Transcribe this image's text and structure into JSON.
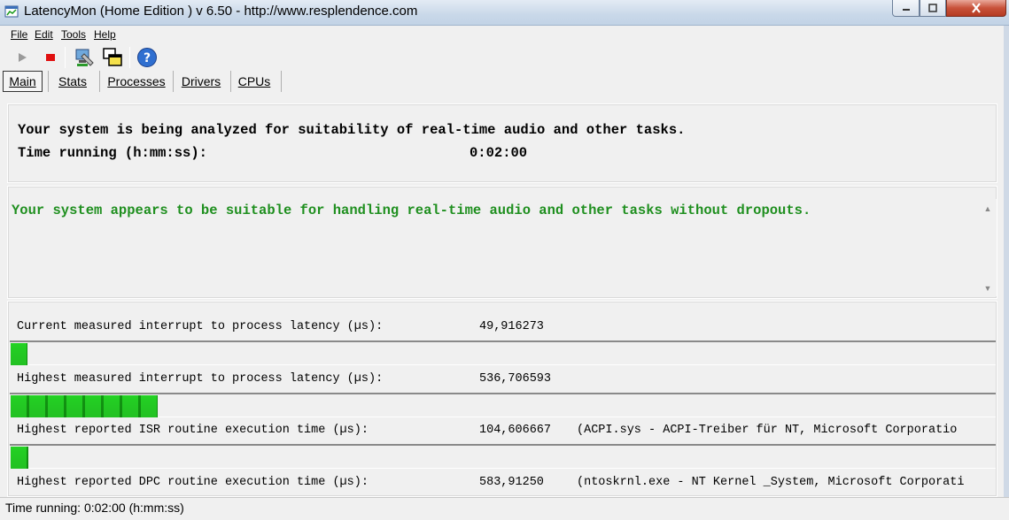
{
  "window": {
    "title": "LatencyMon  (Home Edition )  v 6.50 - http://www.resplendence.com"
  },
  "menu": [
    {
      "label": "File"
    },
    {
      "label": "Edit"
    },
    {
      "label": "Tools"
    },
    {
      "label": "Help"
    }
  ],
  "toolbar": {
    "icons": [
      "play-icon",
      "stop-icon",
      "monitor-icon",
      "windows-icon",
      "help-icon"
    ]
  },
  "tabs": [
    {
      "label": "Main",
      "active": true
    },
    {
      "label": "Stats"
    },
    {
      "label": "Processes"
    },
    {
      "label": "Drivers"
    },
    {
      "label": "CPUs"
    }
  ],
  "status": {
    "line1": "Your system is being analyzed for suitability of real-time audio and other tasks.",
    "time_label": "Time running (h:mm:ss):",
    "time_value": "0:02:00"
  },
  "verdict": {
    "text": "Your system appears to be suitable for handling real-time audio and other tasks without dropouts.",
    "color": "#1f8f1f"
  },
  "metrics": [
    {
      "label": "Current measured interrupt to process latency (µs):",
      "value": "49,916273",
      "info": "",
      "bar_fraction": 0.017
    },
    {
      "label": "Highest measured interrupt to process latency (µs):",
      "value": "536,706593",
      "info": "",
      "bar_fraction": 0.149
    },
    {
      "label": "Highest reported ISR routine execution time (µs):",
      "value": "104,606667",
      "info": "(ACPI.sys - ACPI-Treiber für NT, Microsoft Corporatio",
      "bar_fraction": 0.018
    },
    {
      "label": "Highest reported DPC routine execution time (µs):",
      "value": "583,91250",
      "info": "(ntoskrnl.exe - NT Kernel _System, Microsoft Corporati",
      "bar_fraction": 0
    }
  ],
  "statusbar": {
    "text": "Time running: 0:02:00  (h:mm:ss)"
  },
  "colors": {
    "bar_green": "#22d022",
    "verdict_green": "#1f8f1f"
  }
}
